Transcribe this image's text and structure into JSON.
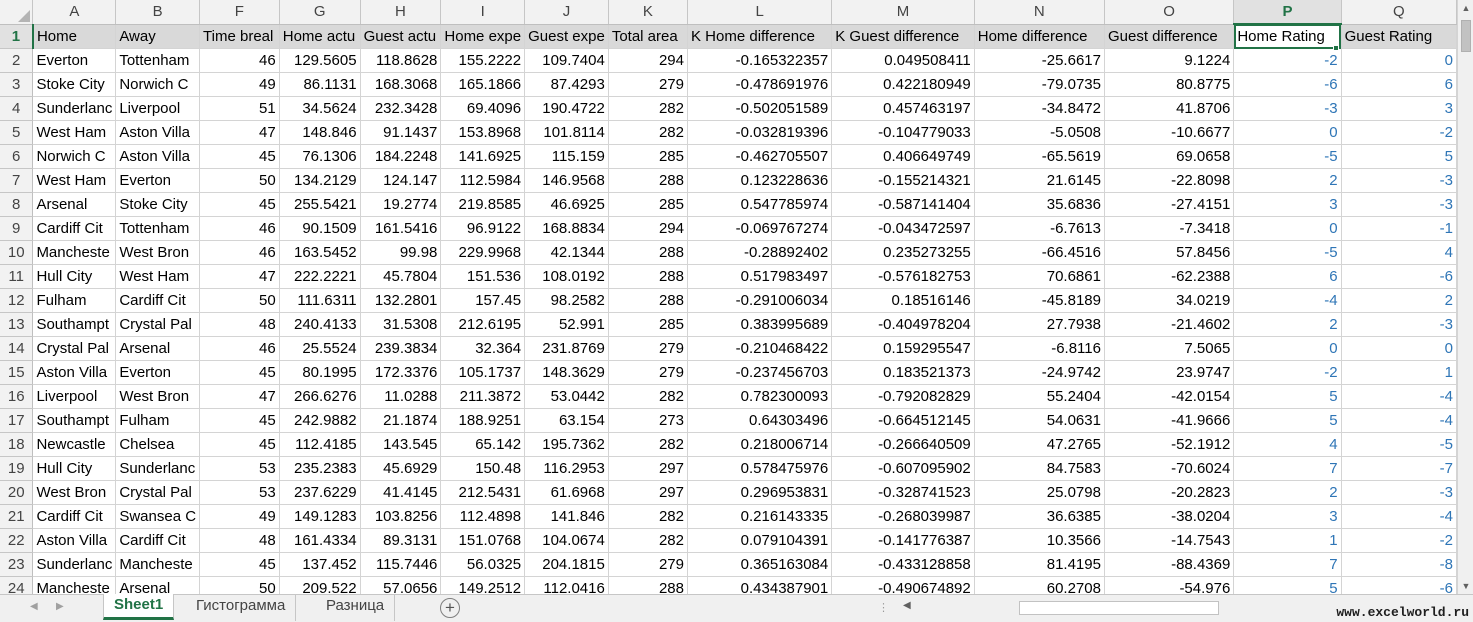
{
  "columns": [
    "A",
    "B",
    "F",
    "G",
    "H",
    "I",
    "J",
    "K",
    "L",
    "M",
    "N",
    "O",
    "P",
    "Q"
  ],
  "selected_column": "P",
  "headers": [
    "Home",
    "Away",
    "Time breal",
    "Home actu",
    "Guest actu",
    "Home expe",
    "Guest expe",
    "Total area",
    "K Home difference",
    "K Guest difference",
    "Home difference",
    "Guest difference",
    "Home Rating",
    "Guest Rating"
  ],
  "rows": [
    {
      "n": "2",
      "c": [
        "Everton",
        "Tottenham",
        "46",
        "129.5605",
        "118.8628",
        "155.2222",
        "109.7404",
        "294",
        "-0.165322357",
        "0.049508411",
        "-25.6617",
        "9.1224",
        "-2",
        "0"
      ]
    },
    {
      "n": "3",
      "c": [
        "Stoke City",
        "Norwich C",
        "49",
        "86.1131",
        "168.3068",
        "165.1866",
        "87.4293",
        "279",
        "-0.478691976",
        "0.422180949",
        "-79.0735",
        "80.8775",
        "-6",
        "6"
      ]
    },
    {
      "n": "4",
      "c": [
        "Sunderlanc",
        "Liverpool",
        "51",
        "34.5624",
        "232.3428",
        "69.4096",
        "190.4722",
        "282",
        "-0.502051589",
        "0.457463197",
        "-34.8472",
        "41.8706",
        "-3",
        "3"
      ]
    },
    {
      "n": "5",
      "c": [
        "West Ham",
        "Aston Villa",
        "47",
        "148.846",
        "91.1437",
        "153.8968",
        "101.8114",
        "282",
        "-0.032819396",
        "-0.104779033",
        "-5.0508",
        "-10.6677",
        "0",
        "-2"
      ]
    },
    {
      "n": "6",
      "c": [
        "Norwich C",
        "Aston Villa",
        "45",
        "76.1306",
        "184.2248",
        "141.6925",
        "115.159",
        "285",
        "-0.462705507",
        "0.406649749",
        "-65.5619",
        "69.0658",
        "-5",
        "5"
      ]
    },
    {
      "n": "7",
      "c": [
        "West Ham",
        "Everton",
        "50",
        "134.2129",
        "124.147",
        "112.5984",
        "146.9568",
        "288",
        "0.123228636",
        "-0.155214321",
        "21.6145",
        "-22.8098",
        "2",
        "-3"
      ]
    },
    {
      "n": "8",
      "c": [
        "Arsenal",
        "Stoke City",
        "45",
        "255.5421",
        "19.2774",
        "219.8585",
        "46.6925",
        "285",
        "0.547785974",
        "-0.587141404",
        "35.6836",
        "-27.4151",
        "3",
        "-3"
      ]
    },
    {
      "n": "9",
      "c": [
        "Cardiff Cit",
        "Tottenham",
        "46",
        "90.1509",
        "161.5416",
        "96.9122",
        "168.8834",
        "294",
        "-0.069767274",
        "-0.043472597",
        "-6.7613",
        "-7.3418",
        "0",
        "-1"
      ]
    },
    {
      "n": "10",
      "c": [
        "Mancheste",
        "West Bron",
        "46",
        "163.5452",
        "99.98",
        "229.9968",
        "42.1344",
        "288",
        "-0.28892402",
        "0.235273255",
        "-66.4516",
        "57.8456",
        "-5",
        "4"
      ]
    },
    {
      "n": "11",
      "c": [
        "Hull City",
        "West Ham",
        "47",
        "222.2221",
        "45.7804",
        "151.536",
        "108.0192",
        "288",
        "0.517983497",
        "-0.576182753",
        "70.6861",
        "-62.2388",
        "6",
        "-6"
      ]
    },
    {
      "n": "12",
      "c": [
        "Fulham",
        "Cardiff Cit",
        "50",
        "111.6311",
        "132.2801",
        "157.45",
        "98.2582",
        "288",
        "-0.291006034",
        "0.18516146",
        "-45.8189",
        "34.0219",
        "-4",
        "2"
      ]
    },
    {
      "n": "13",
      "c": [
        "Southampt",
        "Crystal Pal",
        "48",
        "240.4133",
        "31.5308",
        "212.6195",
        "52.991",
        "285",
        "0.383995689",
        "-0.404978204",
        "27.7938",
        "-21.4602",
        "2",
        "-3"
      ]
    },
    {
      "n": "14",
      "c": [
        "Crystal Pal",
        "Arsenal",
        "46",
        "25.5524",
        "239.3834",
        "32.364",
        "231.8769",
        "279",
        "-0.210468422",
        "0.159295547",
        "-6.8116",
        "7.5065",
        "0",
        "0"
      ]
    },
    {
      "n": "15",
      "c": [
        "Aston Villa",
        "Everton",
        "45",
        "80.1995",
        "172.3376",
        "105.1737",
        "148.3629",
        "279",
        "-0.237456703",
        "0.183521373",
        "-24.9742",
        "23.9747",
        "-2",
        "1"
      ]
    },
    {
      "n": "16",
      "c": [
        "Liverpool",
        "West Bron",
        "47",
        "266.6276",
        "11.0288",
        "211.3872",
        "53.0442",
        "282",
        "0.782300093",
        "-0.792082829",
        "55.2404",
        "-42.0154",
        "5",
        "-4"
      ]
    },
    {
      "n": "17",
      "c": [
        "Southampt",
        "Fulham",
        "45",
        "242.9882",
        "21.1874",
        "188.9251",
        "63.154",
        "273",
        "0.64303496",
        "-0.664512145",
        "54.0631",
        "-41.9666",
        "5",
        "-4"
      ]
    },
    {
      "n": "18",
      "c": [
        "Newcastle",
        "Chelsea",
        "45",
        "112.4185",
        "143.545",
        "65.142",
        "195.7362",
        "282",
        "0.218006714",
        "-0.266640509",
        "47.2765",
        "-52.1912",
        "4",
        "-5"
      ]
    },
    {
      "n": "19",
      "c": [
        "Hull City",
        "Sunderlanc",
        "53",
        "235.2383",
        "45.6929",
        "150.48",
        "116.2953",
        "297",
        "0.578475976",
        "-0.607095902",
        "84.7583",
        "-70.6024",
        "7",
        "-7"
      ]
    },
    {
      "n": "20",
      "c": [
        "West Bron",
        "Crystal Pal",
        "53",
        "237.6229",
        "41.4145",
        "212.5431",
        "61.6968",
        "297",
        "0.296953831",
        "-0.328741523",
        "25.0798",
        "-20.2823",
        "2",
        "-3"
      ]
    },
    {
      "n": "21",
      "c": [
        "Cardiff Cit",
        "Swansea C",
        "49",
        "149.1283",
        "103.8256",
        "112.4898",
        "141.846",
        "282",
        "0.216143335",
        "-0.268039987",
        "36.6385",
        "-38.0204",
        "3",
        "-4"
      ]
    },
    {
      "n": "22",
      "c": [
        "Aston Villa",
        "Cardiff Cit",
        "48",
        "161.4334",
        "89.3131",
        "151.0768",
        "104.0674",
        "282",
        "0.079104391",
        "-0.141776387",
        "10.3566",
        "-14.7543",
        "1",
        "-2"
      ]
    },
    {
      "n": "23",
      "c": [
        "Sunderlanc",
        "Mancheste",
        "45",
        "137.452",
        "115.7446",
        "56.0325",
        "204.1815",
        "279",
        "0.365163084",
        "-0.433128858",
        "81.4195",
        "-88.4369",
        "7",
        "-8"
      ]
    },
    {
      "n": "24",
      "c": [
        "Mancheste",
        "Arsenal",
        "50",
        "209.522",
        "57.0656",
        "149.2512",
        "112.0416",
        "288",
        "0.434387901",
        "-0.490674892",
        "60.2708",
        "-54.976",
        "5",
        "-6"
      ]
    }
  ],
  "sheet_tabs": [
    "Sheet1",
    "Гистограмма",
    "Разница"
  ],
  "active_tab": "Sheet1",
  "watermark": "www.excelworld.ru",
  "colors": {
    "accent": "#217346",
    "rating_text": "#2e75b6",
    "header_fill": "#d9d9d9"
  }
}
